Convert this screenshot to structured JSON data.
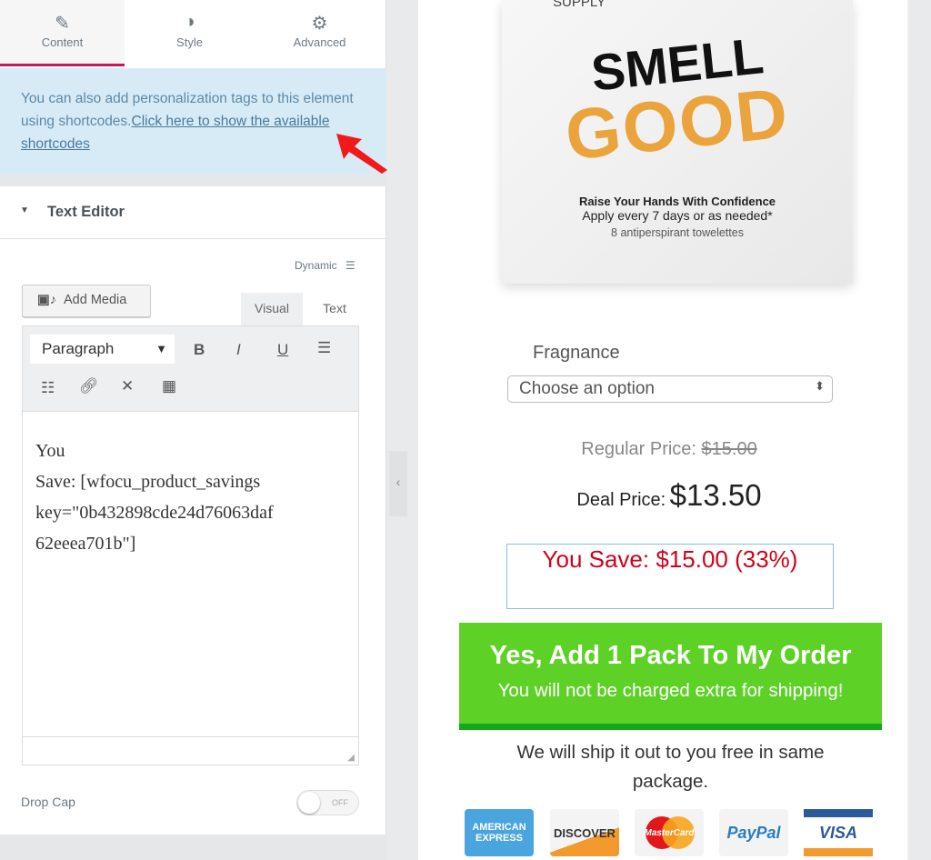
{
  "panel": {
    "tabs": [
      {
        "label": "Content",
        "icon": "pencil-icon"
      },
      {
        "label": "Style",
        "icon": "contrast-icon"
      },
      {
        "label": "Advanced",
        "icon": "gear-icon"
      }
    ],
    "notice_text": "You can also add personalization tags to this element using shortcodes.",
    "notice_link": "Click here to show the available shortcodes",
    "section_title": "Text Editor",
    "dynamic_label": "Dynamic",
    "add_media_label": "Add Media",
    "editor_tabs": [
      "Visual",
      "Text"
    ],
    "format_select": "Paragraph",
    "toolbar": {
      "bold": "B",
      "italic": "I",
      "underline": "U"
    },
    "editor_content": [
      "You",
      "Save: [wfocu_product_savings",
      "key=\"0b432898cde24d76063daf",
      "62eeea701b\"]"
    ],
    "drop_cap_label": "Drop Cap",
    "drop_cap_toggle": "OFF"
  },
  "preview": {
    "product_image": {
      "brand": "SUPPLY",
      "line1": "SMELL",
      "line2": "GOOD",
      "tagline": "Raise Your Hands With Confidence",
      "sub": "Apply every 7 days or as needed*",
      "count": "8 antiperspirant towelettes"
    },
    "variation_label": "Fragnance",
    "variation_select": "Choose an option",
    "regular_price_label": "Regular Price:",
    "regular_price": "$15.00",
    "deal_price_label": "Deal Price:",
    "deal_price": "$13.50",
    "savings": "You Save: $15.00 (33%)",
    "cta_title": "Yes, Add 1 Pack To My Order",
    "cta_sub": "You will not be charged extra for shipping!",
    "ship_note": "We will ship it out to you free in same package.",
    "cards": [
      "AMERICAN EXPRESS",
      "DISCOVER",
      "MasterCard",
      "PayPal",
      "VISA"
    ]
  },
  "colors": {
    "accent": "#c2185b",
    "cta": "#5ed127",
    "savings": "#d0021b",
    "notice_bg": "#d7ebf7"
  }
}
